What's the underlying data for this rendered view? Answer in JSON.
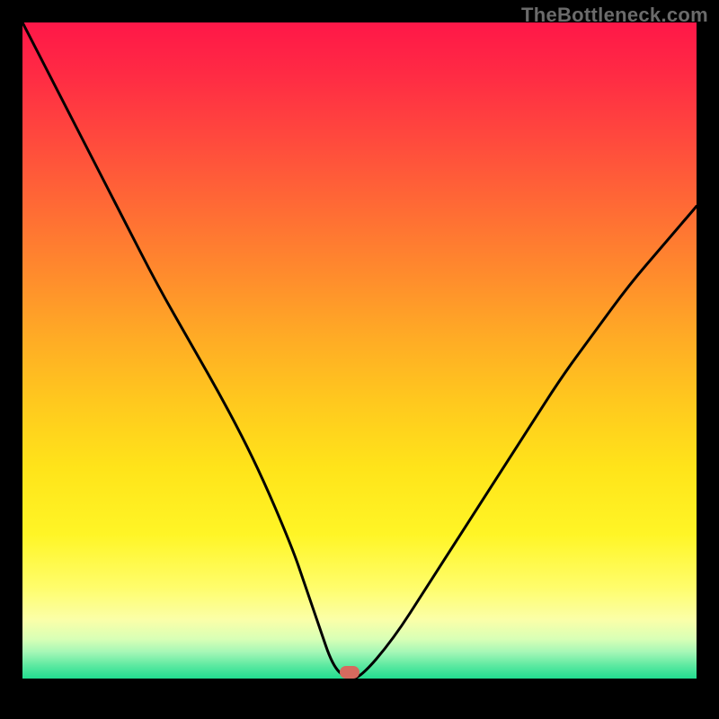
{
  "watermark": "TheBottleneck.com",
  "colors": {
    "frame": "#000000",
    "marker": "#d66a5e",
    "curve": "#000000"
  },
  "chart_data": {
    "type": "line",
    "title": "",
    "xlabel": "",
    "ylabel": "",
    "xlim": [
      0,
      100
    ],
    "ylim": [
      0,
      100
    ],
    "grid": false,
    "legend": false,
    "note": "Background is a vertical heat gradient (red→yellow→green) representing bottleneck severity; the black curve is the bottleneck percentage across the x-axis, reaching ~0 at the marker.",
    "series": [
      {
        "name": "bottleneck-curve",
        "x": [
          0,
          5,
          10,
          15,
          20,
          25,
          30,
          35,
          40,
          42,
          44,
          46,
          48,
          50,
          55,
          60,
          65,
          70,
          75,
          80,
          85,
          90,
          95,
          100
        ],
        "y": [
          100,
          90,
          80,
          70,
          60,
          51,
          42,
          32,
          20,
          14,
          8,
          2,
          0,
          0,
          6,
          14,
          22,
          30,
          38,
          46,
          53,
          60,
          66,
          72
        ]
      }
    ],
    "marker": {
      "x": 48.5,
      "y": 1
    },
    "gradient_stops": [
      {
        "pos": 0,
        "color": "#ff1748"
      },
      {
        "pos": 18,
        "color": "#ff4a3d"
      },
      {
        "pos": 38,
        "color": "#ff8a2d"
      },
      {
        "pos": 58,
        "color": "#ffc91e"
      },
      {
        "pos": 78,
        "color": "#fff526"
      },
      {
        "pos": 91,
        "color": "#fbffa8"
      },
      {
        "pos": 96,
        "color": "#a4f7b6"
      },
      {
        "pos": 100,
        "color": "#22dd90"
      }
    ]
  }
}
